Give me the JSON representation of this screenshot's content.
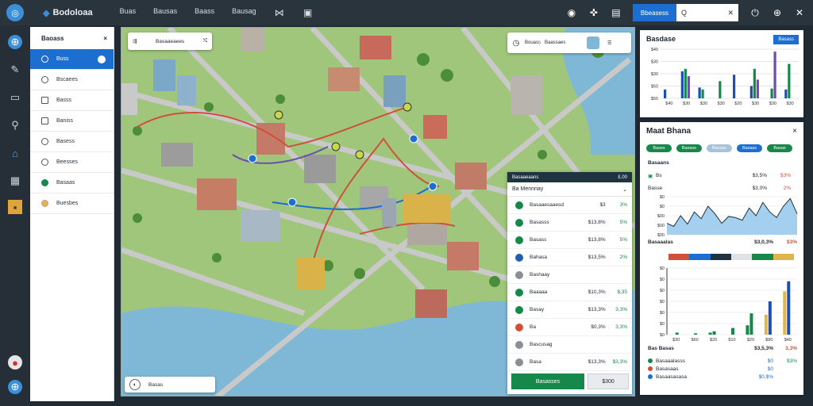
{
  "app": {
    "brand": "Bodoloaa",
    "nav": [
      "Buas",
      "Bausas",
      "Baass",
      "Bausag"
    ],
    "primary_button": "Bbeasess",
    "search_value": "Q",
    "colors": {
      "topbar": "#2a343d",
      "accent": "#1c6fd1",
      "map": "#9fc67a",
      "water": "#7fb8d6",
      "route": "#d0503a",
      "route2": "#6a4fb0",
      "green": "#16894a"
    }
  },
  "rail": {
    "icons": [
      "globe-icon",
      "pen-icon",
      "chart-icon",
      "key-icon",
      "org-icon",
      "grid-icon",
      "note-icon",
      "user-icon",
      "globe-icon"
    ]
  },
  "layers": {
    "title": "Baoass",
    "close": "×",
    "items": [
      "Buss",
      "Bscaees",
      "Basss",
      "Baniss",
      "Basess",
      "Beesses",
      "Basaas",
      "Buesbes"
    ]
  },
  "map": {
    "directions_label": "Basaaeaees",
    "route_info": "Bouass",
    "route_meta": "Baassaes",
    "bottom_label": "Basas"
  },
  "results": {
    "header": "Basaaeaans",
    "header_value": "£.00",
    "subtitle": "Ba Mennnay",
    "rows": [
      {
        "name": "Basaaesaaesd",
        "v1": "$3",
        "v2": "3%",
        "color": "#16894a"
      },
      {
        "name": "Basasss",
        "v1": "$13,8%",
        "v2": "5%",
        "color": "#16894a"
      },
      {
        "name": "Basass",
        "v1": "$13,8%",
        "v2": "5%",
        "color": "#16894a"
      },
      {
        "name": "Bahasa",
        "v1": "$13,5%",
        "v2": "2%",
        "color": "#1f5fb0"
      },
      {
        "name": "Bashaay",
        "v1": "",
        "v2": "",
        "color": "#8a8f93"
      },
      {
        "name": "Baaaaa",
        "v1": "$10,3%",
        "v2": "$,35",
        "color": "#16894a"
      },
      {
        "name": "Basay",
        "v1": "$13,3%",
        "v2": "3,3%",
        "color": "#16894a"
      },
      {
        "name": "Ba",
        "v1": "$0,3%",
        "v2": "3,3%",
        "color": "#d0503a"
      },
      {
        "name": "Bascusag",
        "v1": "",
        "v2": "",
        "color": "#8a8f93"
      },
      {
        "name": "Basa",
        "v1": "$13,3%",
        "v2": "$3,3%",
        "color": "#8a8f93"
      }
    ],
    "go_button": "Basasses",
    "alt_button": "$300"
  },
  "panel_top": {
    "title": "Basdase",
    "button": "Basass",
    "chart_data": {
      "type": "bar",
      "categories": [
        "$40",
        "$30",
        "$30",
        "$30",
        "$20",
        "$30",
        "$30",
        "$30"
      ],
      "series": [
        {
          "values": [
            18,
            55,
            22,
            0,
            48,
            25,
            0,
            18
          ],
          "color": "#1c4fae"
        },
        {
          "values": [
            0,
            60,
            18,
            35,
            0,
            60,
            20,
            70
          ],
          "color": "#16894a"
        },
        {
          "values": [
            0,
            45,
            0,
            0,
            0,
            38,
            95,
            0
          ],
          "color": "#6a4fb0"
        },
        {
          "values": [
            0,
            0,
            0,
            0,
            0,
            0,
            0,
            0
          ],
          "color": "#d0503a"
        }
      ],
      "ylim": [
        0,
        100
      ],
      "yticks": [
        "$40",
        "$30",
        "$30",
        "$50",
        "$50"
      ]
    }
  },
  "panel_main": {
    "title": "Maat Bhana",
    "close": "×",
    "chips": [
      {
        "label": "Bases",
        "color": "#16894a"
      },
      {
        "label": "Basase",
        "color": "#16894a"
      },
      {
        "label": "Bassas",
        "color": "#a9c2db"
      },
      {
        "label": "Basass",
        "color": "#1c6fd1"
      },
      {
        "label": "Basas",
        "color": "#16894a"
      }
    ],
    "section1": "Basaans",
    "item1": {
      "name": "Bs",
      "v": "$3,5%",
      "p": "$3%"
    },
    "item2": {
      "name": "Basse",
      "v": "$3,0%",
      "p": "2%"
    },
    "line_chart": {
      "type": "area",
      "yticks": [
        "$0",
        "$0",
        "$00",
        "$00",
        "$00"
      ],
      "values": [
        30,
        22,
        50,
        28,
        60,
        42,
        75,
        55,
        30,
        48,
        45,
        38,
        70,
        50,
        85,
        60,
        45,
        75,
        95,
        55
      ]
    },
    "section2": "Basaaalas",
    "section2_v": "$3,0,3%",
    "section2_p": "$3%",
    "stack_colors": [
      "#d0503a",
      "#1c6fd1",
      "#1f3340",
      "#e0e3e6",
      "#16894a",
      "#e0b64a"
    ],
    "bar_chart": {
      "type": "bar",
      "categories": [
        "$30",
        "$60",
        "$20",
        "$10",
        "$20",
        "$90",
        "$40"
      ],
      "values": [
        3,
        2,
        5,
        10,
        32,
        50,
        80
      ],
      "series2": [
        0,
        0,
        3,
        0,
        14,
        30,
        65
      ],
      "yticks": [
        "$0",
        "$0",
        "$0",
        "$0",
        "$0",
        "$0",
        "$0"
      ],
      "ylim": [
        0,
        100
      ]
    },
    "footer_label": "Bas Basas",
    "footer_v": "$3,5,3%",
    "footer_p": "3,3%",
    "foot_rows": [
      {
        "name": "Basaaalasss",
        "v": "$0",
        "p": "$3%",
        "color": "#16894a"
      },
      {
        "name": "Basasaas",
        "v": "$0",
        "p": "",
        "color": "#d0503a"
      },
      {
        "name": "Basaasasasa",
        "v": "$0,$%",
        "p": "",
        "color": "#1c6fd1"
      }
    ]
  }
}
